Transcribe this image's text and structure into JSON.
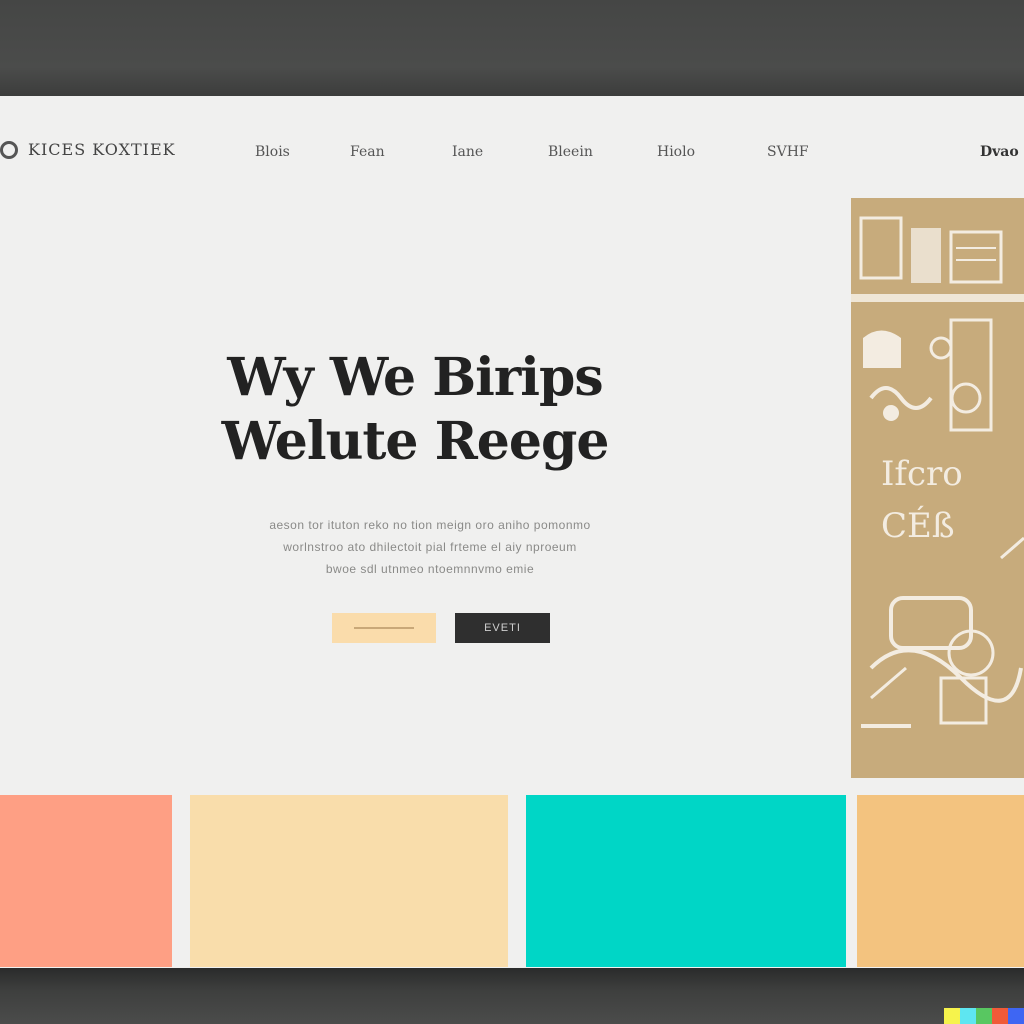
{
  "nav": {
    "logo_text": "KICES KOXTIEK",
    "items": [
      "Blois",
      "Fean",
      "Iane",
      "Bleein",
      "Hiolo",
      "SVHF",
      "Dvao"
    ]
  },
  "hero": {
    "headline_line1": "Wy We Birips",
    "headline_line2": "Welute Reege",
    "sub_line1": "aeson tor ituton reko no tion meign oro aniho pomonmo",
    "sub_line2": "worlnstroo ato dhilectoit pial frteme el aiy nproeum",
    "sub_line3": "bwoe sdl utnmeo ntoemnnvmo emie",
    "primary_button_label": "",
    "secondary_button_label": "EVETI"
  },
  "illustration": {
    "text_line1": "Ifcro",
    "text_line2": "CÉß"
  },
  "swatches": {
    "colors": [
      "#fe9f84",
      "#f9ddab",
      "#00d6c6",
      "#f3c37f"
    ]
  },
  "colors": {
    "screen_bg": "#f0f0ef",
    "panel_gold": "#c7ab7c",
    "button_dark": "#2f2f2f"
  }
}
